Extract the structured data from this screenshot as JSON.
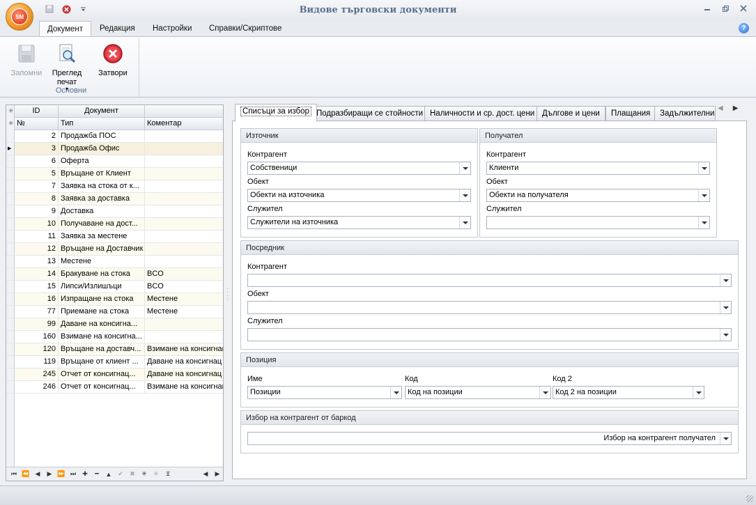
{
  "window": {
    "title": "Видове търговски документи",
    "logo_text": "SM"
  },
  "ribbon_tabs": [
    {
      "label": "Документ",
      "active": true
    },
    {
      "label": "Редакция",
      "active": false
    },
    {
      "label": "Настройки",
      "active": false
    },
    {
      "label": "Справки/Скриптове",
      "active": false
    }
  ],
  "ribbon": {
    "save": "Запомни",
    "preview_line1": "Преглед",
    "preview_line2": "печат",
    "close": "Затвори",
    "group_label": "Основни"
  },
  "grid": {
    "header_row1": {
      "id": "ID",
      "document": "Документ"
    },
    "header_row2": {
      "num": "№",
      "type": "Тип",
      "comment": "Коментар"
    },
    "rows": [
      {
        "num": "2",
        "type": "Продажба ПОС",
        "comment": ""
      },
      {
        "num": "3",
        "type": "Продажба Офис",
        "comment": ""
      },
      {
        "num": "6",
        "type": "Оферта",
        "comment": ""
      },
      {
        "num": "5",
        "type": "Връщане от Клиент",
        "comment": ""
      },
      {
        "num": "7",
        "type": "Заявка на стока от к...",
        "comment": ""
      },
      {
        "num": "8",
        "type": "Заявка за доставка",
        "comment": ""
      },
      {
        "num": "9",
        "type": "Доставка",
        "comment": ""
      },
      {
        "num": "10",
        "type": "Получаване на дост...",
        "comment": ""
      },
      {
        "num": "11",
        "type": "Заявка за местене",
        "comment": ""
      },
      {
        "num": "12",
        "type": "Връщане на Доставчик",
        "comment": ""
      },
      {
        "num": "13",
        "type": "Местене",
        "comment": ""
      },
      {
        "num": "14",
        "type": "Бракуване на стока",
        "comment": "BCO"
      },
      {
        "num": "15",
        "type": "Липси/Излишъци",
        "comment": "BCO"
      },
      {
        "num": "16",
        "type": "Изпращане на стока",
        "comment": "Местене"
      },
      {
        "num": "77",
        "type": "Приемане на стока",
        "comment": "Местене"
      },
      {
        "num": "99",
        "type": "Даване на консигна...",
        "comment": ""
      },
      {
        "num": "160",
        "type": "Взимане на консигна...",
        "comment": ""
      },
      {
        "num": "120",
        "type": "Връщане на доставч...",
        "comment": "Взимане на консигнац"
      },
      {
        "num": "119",
        "type": "Връщане от клиент ...",
        "comment": "Даване на консигнац"
      },
      {
        "num": "245",
        "type": "Отчет от консигнац...",
        "comment": "Даване на консигнац"
      },
      {
        "num": "246",
        "type": "Отчет от консигнац...",
        "comment": "Взимане на консигнац"
      }
    ]
  },
  "tabs": [
    {
      "label": "Списъци за избор",
      "active": true
    },
    {
      "label": "Подразбиращи се стойности",
      "active": false
    },
    {
      "label": "Наличности и ср. дост. цени",
      "active": false
    },
    {
      "label": "Дългове и цени",
      "active": false
    },
    {
      "label": "Плащания",
      "active": false
    },
    {
      "label": "Задължителни",
      "active": false
    }
  ],
  "source": {
    "title": "Източник",
    "contractor_label": "Контрагент",
    "contractor_value": "Собственици",
    "object_label": "Обект",
    "object_value": "Обекти на източника",
    "employee_label": "Служител",
    "employee_value": "Служители на източника"
  },
  "recipient": {
    "title": "Получател",
    "contractor_label": "Контрагент",
    "contractor_value": "Клиенти",
    "object_label": "Обект",
    "object_value": "Обекти на получателя",
    "employee_label": "Служител",
    "employee_value": ""
  },
  "intermediary": {
    "title": "Посредник",
    "contractor_label": "Контрагент",
    "contractor_value": "",
    "object_label": "Обект",
    "object_value": "",
    "employee_label": "Служител",
    "employee_value": ""
  },
  "position": {
    "title": "Позиция",
    "name_label": "Име",
    "name_value": "Позиции",
    "code_label": "Код",
    "code_value": "Код на позиции",
    "code2_label": "Код 2",
    "code2_value": "Код 2 на позиции"
  },
  "barcode": {
    "title": "Избор на контрагент от баркод",
    "value": "Избор на контрагент получател"
  }
}
